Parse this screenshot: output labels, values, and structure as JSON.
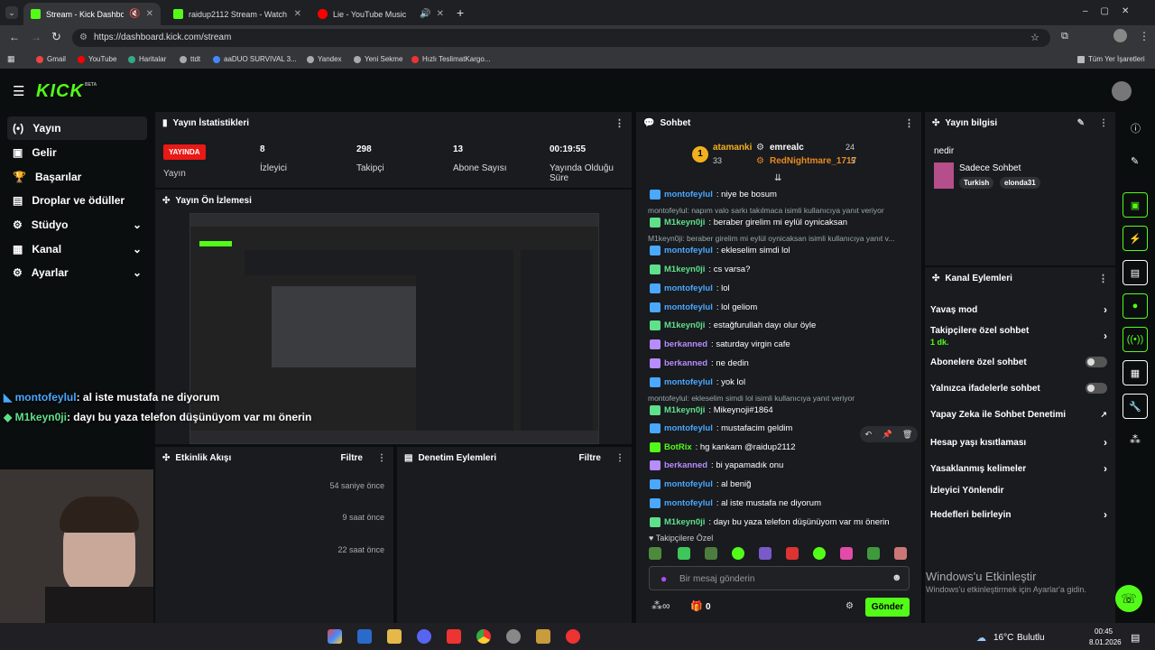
{
  "browser": {
    "tabs": [
      {
        "title": "Stream - Kick Dashboard"
      },
      {
        "title": "raidup2112 Stream - Watch Live"
      },
      {
        "title": "Lie - YouTube Music"
      }
    ],
    "url": "https://dashboard.kick.com/stream",
    "bookmarks": [
      "Gmail",
      "YouTube",
      "Haritalar",
      "ttdt",
      "aaDUO SURVIVAL 3...",
      "Yandex",
      "Yeni Sekme",
      "Hızlı TeslimatKargo..."
    ],
    "all_bookmarks": "Tüm Yer İşaretleri"
  },
  "logo": "KICK",
  "logo_sup": "BETA",
  "sidebar": {
    "items": [
      {
        "label": "Yayın"
      },
      {
        "label": "Gelir"
      },
      {
        "label": "Başarılar"
      },
      {
        "label": "Droplar ve ödüller"
      },
      {
        "label": "Stüdyo"
      },
      {
        "label": "Kanal"
      },
      {
        "label": "Ayarlar"
      }
    ]
  },
  "stats": {
    "title": "Yayın İstatistikleri",
    "live_badge": "YAYINDA",
    "live_label": "Yayın",
    "items": [
      {
        "value": "8",
        "label": "İzleyici"
      },
      {
        "value": "298",
        "label": "Takipçi"
      },
      {
        "value": "13",
        "label": "Abone Sayısı"
      },
      {
        "value": "00:19:55",
        "label": "Yayında Olduğu Süre"
      }
    ]
  },
  "preview": {
    "title": "Yayın Ön İzlemesi"
  },
  "overlay": {
    "lines": [
      {
        "user": "montofeylul",
        "text": ": al iste mustafa ne diyorum"
      },
      {
        "user": "M1keyn0ji",
        "text": ": dayı bu yaza telefon düşünüyom var mı önerin"
      }
    ]
  },
  "activity": {
    "title": "Etkinlik Akışı",
    "filter": "Filtre",
    "times": [
      "54 saniye önce",
      "9 saat önce",
      "22 saat önce"
    ]
  },
  "moderation": {
    "title": "Denetim Eylemleri",
    "filter": "Filtre"
  },
  "chat": {
    "title": "Sohbet",
    "top": {
      "user1": "atamanki",
      "count1": "33",
      "user2": "emrealc",
      "count2": "24",
      "user3": "RedNightmare_1717",
      "count3": "5"
    },
    "messages": [
      {
        "user": "montofeylul",
        "text": ": niye be bosum",
        "color": "#4aa8ff"
      },
      {
        "sys": "montofeylul: napım valo sarkı takılmaca isimli kullanıcıya yanıt veriyor"
      },
      {
        "user": "M1keyn0ji",
        "text": ": beraber girelim mi eylül oynicaksan",
        "color": "#5fe08a"
      },
      {
        "sys": "M1keyn0ji: beraber girelim mi eylül oynicaksan isimli kullanıcıya yanıt v..."
      },
      {
        "user": "montofeylul",
        "text": ": ekleselim simdi lol",
        "color": "#4aa8ff"
      },
      {
        "user": "M1keyn0ji",
        "text": ": cs varsa?",
        "color": "#5fe08a"
      },
      {
        "user": "montofeylul",
        "text": ": lol",
        "color": "#4aa8ff"
      },
      {
        "user": "montofeylul",
        "text": ": lol geliom",
        "color": "#4aa8ff"
      },
      {
        "user": "M1keyn0ji",
        "text": ": estağfurullah dayı olur öyle",
        "color": "#5fe08a"
      },
      {
        "user": "berkanned",
        "text": ": saturday virgin cafe",
        "color": "#b78cff"
      },
      {
        "user": "berkanned",
        "text": ": ne dedin",
        "color": "#b78cff"
      },
      {
        "user": "montofeylul",
        "text": ": yok lol",
        "color": "#4aa8ff"
      },
      {
        "sys": "montofeylul: ekleselim simdi lol isimli kullanıcıya yanıt veriyor"
      },
      {
        "user": "M1keyn0ji",
        "text": ": Mikeynoji#1864",
        "color": "#5fe08a"
      },
      {
        "user": "montofeylul",
        "text": ": mustafacim geldim",
        "color": "#4aa8ff"
      },
      {
        "user": "BotRix",
        "text": ": hg kankam @raidup2112",
        "color": "#53fc18"
      },
      {
        "user": "berkanned",
        "text": ": bi yapamadık onu",
        "color": "#b78cff"
      },
      {
        "user": "montofeylul",
        "text": ": al beniğ",
        "color": "#4aa8ff"
      },
      {
        "user": "montofeylul",
        "text": ": al iste mustafa ne diyorum",
        "color": "#4aa8ff"
      },
      {
        "user": "M1keyn0ji",
        "text": ": dayı bu yaza telefon düşünüyom var mı önerin",
        "color": "#5fe08a"
      }
    ],
    "followers_only": "Takipçilere Özel",
    "placeholder": "Bir mesaj gönderin",
    "points": "0",
    "send": "Gönder"
  },
  "info": {
    "title": "Yayın bilgisi",
    "stream_title": "nedir",
    "category": "Sadece Sohbet",
    "tags": [
      "Turkish",
      "elonda31"
    ]
  },
  "channel_actions": {
    "title": "Kanal Eylemleri",
    "items": [
      {
        "label": "Yavaş mod"
      },
      {
        "label": "Takipçilere özel sohbet",
        "sub": "1 dk."
      },
      {
        "label": "Abonelere özel sohbet"
      },
      {
        "label": "Yalnızca ifadelerle sohbet"
      },
      {
        "label": "Yapay Zeka ile Sohbet Denetimi"
      },
      {
        "label": "Hesap yaşı kısıtlaması"
      },
      {
        "label": "Yasaklanmış kelimeler"
      },
      {
        "label": "İzleyici Yönlendir"
      },
      {
        "label": "Hedefleri belirleyin"
      }
    ]
  },
  "watermark": {
    "line1": "Windows'u Etkinleştir",
    "line2": "Windows'u etkinleştirmek için Ayarlar'a gidin."
  },
  "taskbar": {
    "weather": "16°C",
    "weather_text": "Bulutlu",
    "time": "00:45",
    "date": "8.01.2026"
  },
  "colors": {
    "accent": "#53fc18",
    "live": "#e91916"
  }
}
